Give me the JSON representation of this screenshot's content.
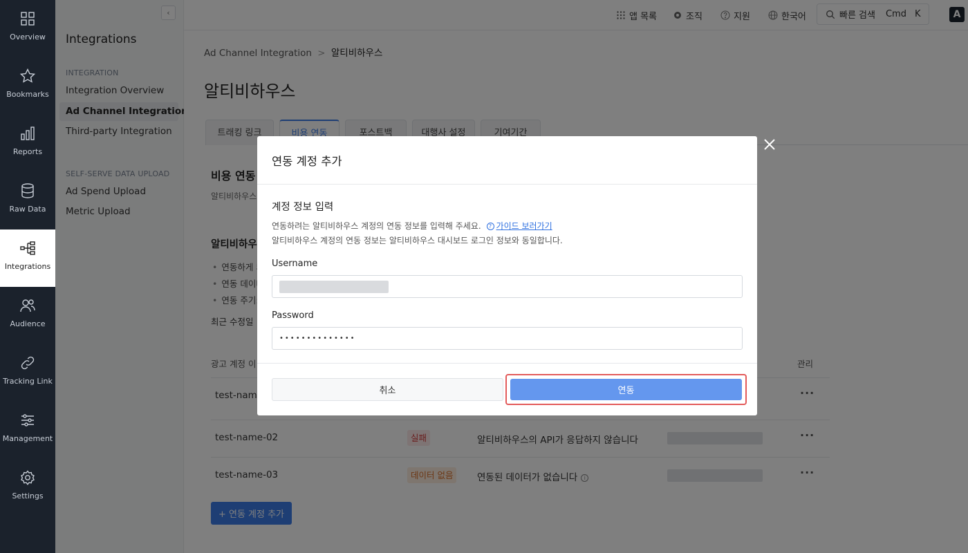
{
  "rail": {
    "items": [
      {
        "label": "Overview",
        "icon": "grid-icon"
      },
      {
        "label": "Bookmarks",
        "icon": "star-icon"
      },
      {
        "label": "Reports",
        "icon": "bar-chart-icon"
      },
      {
        "label": "Raw Data",
        "icon": "database-icon"
      },
      {
        "label": "Integrations",
        "icon": "integrations-icon"
      },
      {
        "label": "Audience",
        "icon": "audience-icon"
      },
      {
        "label": "Tracking Link",
        "icon": "link-icon"
      },
      {
        "label": "Management",
        "icon": "sliders-icon"
      },
      {
        "label": "Settings",
        "icon": "gear-icon"
      }
    ],
    "active": "Integrations"
  },
  "sidebar": {
    "title": "Integrations",
    "section1": "INTEGRATION",
    "links1": [
      "Integration Overview",
      "Ad Channel Integration",
      "Third-party Integration"
    ],
    "section2": "SELF-SERVE DATA UPLOAD",
    "links2": [
      "Ad Spend Upload",
      "Metric Upload"
    ],
    "active": "Ad Channel Integration",
    "collapse": "‹"
  },
  "topbar": {
    "apps": "앱 목록",
    "org": "조직",
    "support": "지원",
    "language": "한국어",
    "search": "빠른 검색",
    "kbd1": "Cmd",
    "kbd2": "K",
    "avatar": "A"
  },
  "main": {
    "breadcrumb_parent": "Ad Channel Integration",
    "breadcrumb_sep": ">",
    "breadcrumb_current": "알티비하우스",
    "title": "알티비하우스",
    "tabs": [
      "트래킹 링크",
      "비용 연동",
      "포스트백",
      "대행사 설정",
      "기여기간"
    ],
    "active_tab": "비용 연동",
    "section_title": "비용 연동",
    "section_sub": "알티비하우스",
    "section2_title": "알티비하우",
    "bullets": [
      "연동하게 되",
      "연동 데이터",
      "연동 주기:"
    ],
    "modified": "최근 수정일",
    "table_head_account": "광고 계정 이",
    "table_head_manage": "관리",
    "rows": [
      {
        "name": "test-name",
        "status": "",
        "message": ""
      },
      {
        "name": "test-name-02",
        "status": "실패",
        "message": "알티비하우스의 API가 응답하지 않습니다"
      },
      {
        "name": "test-name-03",
        "status": "데이터 없음",
        "message": "연동된 데이터가 없습니다"
      }
    ],
    "more": "···",
    "add_button": "+ 연동 계정 추가"
  },
  "modal": {
    "title": "연동 계정 추가",
    "subtitle": "계정 정보 입력",
    "desc1": "연동하려는 알티비하우스 계정의 연동 정보를 입력해 주세요.",
    "guide_link": "가이드 보러가기",
    "desc2": "알티비하우스 계정의 연동 정보는 알티비하우스 대시보드 로그인 정보와 동일합니다.",
    "username_label": "Username",
    "password_label": "Password",
    "password_value": "••••••••••••••",
    "cancel": "취소",
    "confirm": "연동"
  },
  "colors": {
    "accent": "#3c7ce8",
    "rail_bg": "#1b222c",
    "confirm_button": "#6497ee",
    "highlight_ring": "#e35a5a"
  }
}
